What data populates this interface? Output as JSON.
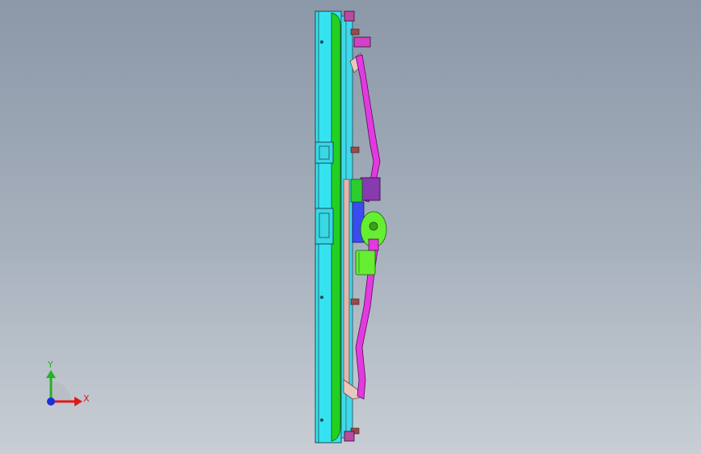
{
  "triad": {
    "x_label": "X",
    "y_label": "Y",
    "x_color": "#e01818",
    "y_color": "#21b321",
    "z_color": "#1c2fd6"
  },
  "model_colors": {
    "frame": "#35e3f0",
    "seal_strip": "#22d022",
    "linkage_rod": "#e02ee0",
    "motor": "#66ee33",
    "pivot_bracket": "#c8a0a0",
    "blue_bracket": "#3a4cf0"
  }
}
